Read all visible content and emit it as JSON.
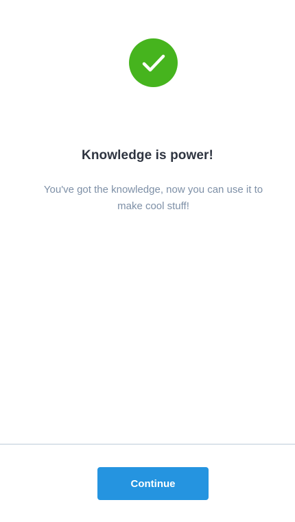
{
  "success": {
    "icon": "checkmark-circle-icon",
    "color": "#46b41e"
  },
  "content": {
    "title": "Knowledge is power!",
    "message": "You've got the knowledge, now you can use it to make cool stuff!"
  },
  "footer": {
    "continue_label": "Continue",
    "continue_color": "#2594e0"
  }
}
